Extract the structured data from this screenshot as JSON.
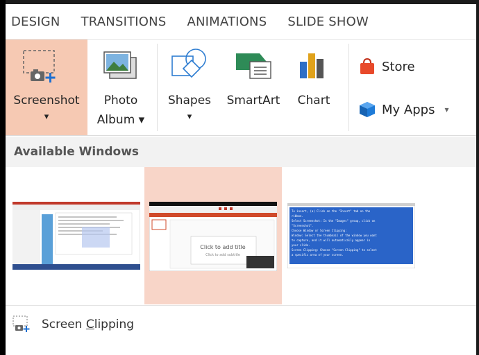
{
  "tabs": [
    "DESIGN",
    "TRANSITIONS",
    "ANIMATIONS",
    "SLIDE SHOW"
  ],
  "ribbon": {
    "screenshot": {
      "line1": "Screenshot",
      "line2": "▾"
    },
    "photo_album": {
      "line1": "Photo",
      "line2": "Album ▾"
    },
    "shapes": {
      "line1": "Shapes",
      "line2": "▾"
    },
    "smartart": {
      "line1": "SmartArt"
    },
    "chart": {
      "line1": "Chart"
    },
    "store": {
      "label": "Store"
    },
    "my_apps": {
      "label": "My Apps",
      "arrow": "▾"
    }
  },
  "available_windows": {
    "header": "Available Windows",
    "thumb3_lines": [
      "To insert, (a) Click on the \"Insert\" tab on the",
      "ribbon.",
      "Select Screenshot: In the \"Images\" group, click on",
      "\"Screenshot\".",
      "Choose Window or Screen Clipping:",
      "Window: Select the thumbnail of the window you want",
      "to capture, and it will automatically appear in",
      "your slide.",
      "Screen Clipping: Choose \"Screen Clipping\" to select",
      "a specific area of your screen."
    ],
    "thumb2_title": "Click to add title",
    "thumb2_sub": "Click to add subtitle"
  },
  "screen_clipping": {
    "prefix": "Screen ",
    "underlined": "C",
    "suffix": "lipping"
  },
  "colors": {
    "selected_bg": "#f6c9b3",
    "header_bg": "#f2f2f2",
    "store_red": "#e8492a",
    "myapps_blue": "#1e7bd8",
    "shapes_blue": "#2e7dd1",
    "smartart_green": "#2e8b57"
  }
}
